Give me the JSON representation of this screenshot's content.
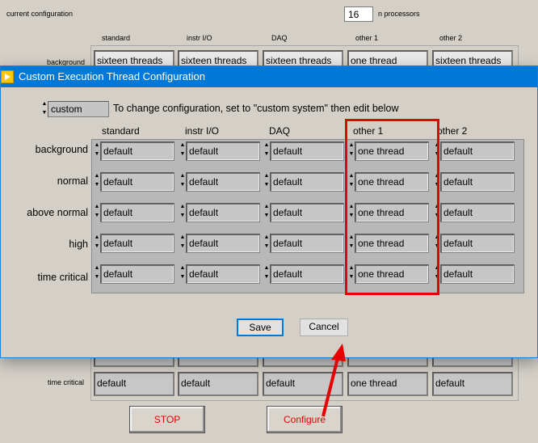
{
  "background": {
    "current_configuration_label": "current configuration",
    "processors_value": "16",
    "processors_label": "n processors",
    "columns": [
      "standard",
      "instr I/O",
      "DAQ",
      "other 1",
      "other 2"
    ],
    "background_row_label": "background",
    "background_row": [
      "sixteen threads",
      "sixteen threads",
      "sixteen threads",
      "one thread",
      "sixteen threads"
    ],
    "time_critical_label": "time critical",
    "time_critical_row": [
      "default",
      "default",
      "default",
      "one thread",
      "default"
    ],
    "stop_label": "STOP",
    "configure_label": "Configure"
  },
  "dialog": {
    "title": "Custom Execution Thread Configuration",
    "config_value": "custom",
    "hint": "To change configuration, set to \"custom system\" then edit below",
    "columns": [
      "standard",
      "instr I/O",
      "DAQ",
      "other 1",
      "other 2"
    ],
    "rows": [
      {
        "label": "background",
        "values": [
          "default",
          "default",
          "default",
          "one thread",
          "default"
        ]
      },
      {
        "label": "normal",
        "values": [
          "default",
          "default",
          "default",
          "one thread",
          "default"
        ]
      },
      {
        "label": "above normal",
        "values": [
          "default",
          "default",
          "default",
          "one thread",
          "default"
        ]
      },
      {
        "label": "high",
        "values": [
          "default",
          "default",
          "default",
          "one thread",
          "default"
        ]
      },
      {
        "label": "time critical",
        "values": [
          "default",
          "default",
          "default",
          "one thread",
          "default"
        ]
      }
    ],
    "save_label": "Save",
    "cancel_label": "Cancel"
  },
  "colors": {
    "titlebar": "#0078d7",
    "annotation": "#e60000",
    "stop_text": "#e30000"
  },
  "icons": {
    "title_icon": "labview-vi-icon",
    "spinner": "up-down-spinner-icon"
  }
}
